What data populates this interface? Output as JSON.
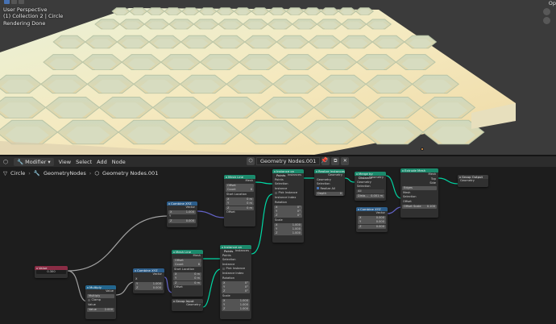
{
  "viewport": {
    "perspective": "User Perspective",
    "collection": "(1) Collection 2 | Circle",
    "status": "Rendering Done",
    "corner_label": "Op"
  },
  "colors": {
    "accent": "#4772b3",
    "geometry_header": "#1b8a6c",
    "vector_header": "#2c5d8a",
    "input_header": "#8a2c45",
    "wire_geometry": "#00d6a3",
    "wire_vector": "#6363c7",
    "wire_float": "#a1a1a1"
  },
  "header": {
    "editor_icon": "node-editor-icon",
    "modifier_label": "Modifier",
    "menus": [
      "View",
      "Select",
      "Add",
      "Node"
    ],
    "tree_name": "Geometry Nodes.001"
  },
  "breadcrumb": {
    "object": "Circle",
    "modifier": "GeometryNodes",
    "tree": "Geometry Nodes.001"
  },
  "nodes": {
    "value": {
      "title": "Value",
      "value": "0.300"
    },
    "multiply": {
      "title": "Multiply",
      "out_label": "Value",
      "op": "Multiply",
      "clamp": "Clamp",
      "in_label": "Value",
      "value": "2.000"
    },
    "combine1": {
      "title": "Combine XYZ",
      "out_label": "Vector",
      "x": "X",
      "x_val": "1.000",
      "y": "Y",
      "z": "Z",
      "z_val": "0.000"
    },
    "combine2": {
      "title": "Combine XYZ",
      "out_label": "Vector",
      "x": "X",
      "y": "Y",
      "y_val": "1.000",
      "z": "Z",
      "z_val": "0.000"
    },
    "combine3": {
      "title": "Combine XYZ",
      "out_label": "Vector",
      "x": "X",
      "x_val": "0.000",
      "y": "Y",
      "y_val": "0.000",
      "z": "Z",
      "z_val": "0.000"
    },
    "meshline1": {
      "title": "Mesh Line",
      "out_label": "Mesh",
      "mode": "Offset",
      "count_label": "Count",
      "count": "8",
      "start_label": "Start Location",
      "x": "X",
      "x_val": "0 m",
      "y": "Y",
      "y_val": "0 m",
      "z": "Z",
      "z_val": "0 m",
      "offset": "Offset"
    },
    "meshline2": {
      "title": "Mesh Line",
      "out_label": "Mesh",
      "mode": "Offset",
      "count_label": "Count",
      "count": "8",
      "start_label": "Start Location",
      "x": "X",
      "x_val": "0 m",
      "y": "Y",
      "y_val": "0 m",
      "z": "Z",
      "z_val": "0 m",
      "offset": "Offset"
    },
    "inst1": {
      "title": "Instance on Points",
      "out_label": "Instances",
      "points": "Points",
      "selection": "Selection",
      "instance": "Instance",
      "pick": "Pick Instance",
      "index": "Instance Index",
      "rotation": "Rotation",
      "x": "X",
      "rx": "0°",
      "y": "Y",
      "ry": "0°",
      "z": "Z",
      "rz": "0°",
      "scale": "Scale",
      "sx": "1.000",
      "sy": "1.000",
      "sz": "1.000"
    },
    "inst2": {
      "title": "Instance on Points",
      "out_label": "Instances",
      "points": "Points",
      "selection": "Selection",
      "instance": "Instance",
      "pick": "Pick Instance",
      "index": "Instance Index",
      "rotation": "Rotation",
      "x": "X",
      "rx": "0°",
      "y": "Y",
      "ry": "0°",
      "z": "Z",
      "rz": "0°",
      "scale": "Scale",
      "sx": "1.000",
      "sy": "1.000",
      "sz": "1.000"
    },
    "realize": {
      "title": "Realize Instances",
      "out_label": "Geometry",
      "geometry": "Geometry",
      "selection": "Selection",
      "realize_all": "Realize All",
      "depth": "Depth",
      "depth_val": "0"
    },
    "merge": {
      "title": "Merge by Distance",
      "out_label": "Geometry",
      "geometry": "Geometry",
      "selection": "Selection",
      "mode": "All",
      "distance": "Dista…",
      "distance_val": "0.001 m"
    },
    "extrude": {
      "title": "Extrude Mesh",
      "out_mesh": "Mesh",
      "out_top": "Top",
      "out_side": "Side",
      "mode": "Edges",
      "mesh": "Mesh",
      "selection": "Selection",
      "offset": "Offset",
      "scale_label": "Offset Scale",
      "scale_val": "0.100"
    },
    "group_output": {
      "title": "Group Output",
      "geometry": "Geometry"
    },
    "group_input": {
      "title": "Group Input",
      "geometry": "Geometry"
    }
  }
}
